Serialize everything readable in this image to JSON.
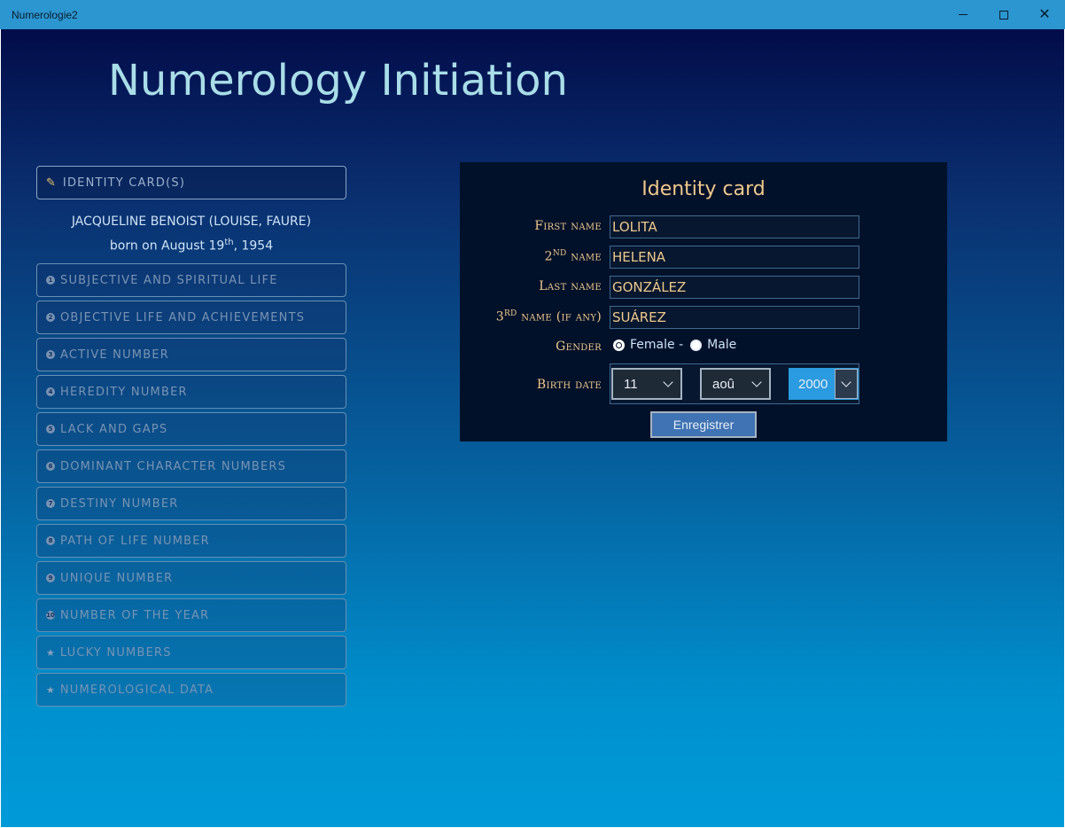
{
  "window": {
    "title": "Numerologie2",
    "minimize_icon": "minimize-icon",
    "maximize_icon": "maximize-icon",
    "close_glyph": "✕"
  },
  "header": {
    "title": "Numerology Initiation"
  },
  "menu": {
    "identity": {
      "label": "IDENTITY CARD(S)",
      "icon": "pen-icon"
    },
    "person": {
      "name_line": "JACQUELINE BENOIST (LOUISE, FAURE)",
      "born_prefix": "born on August 19",
      "born_suffix_sup": "th",
      "born_year": ", 1954"
    },
    "items": [
      {
        "label": "SUBJECTIVE AND SPIRITUAL LIFE",
        "bullet": "1"
      },
      {
        "label": "OBJECTIVE LIFE AND ACHIEVEMENTS",
        "bullet": "2"
      },
      {
        "label": "ACTIVE NUMBER",
        "bullet": "3"
      },
      {
        "label": "HEREDITY NUMBER",
        "bullet": "4"
      },
      {
        "label": "LACK AND GAPS",
        "bullet": "5"
      },
      {
        "label": "DOMINANT CHARACTER NUMBERS",
        "bullet": "6"
      },
      {
        "label": "DESTINY NUMBER",
        "bullet": "7"
      },
      {
        "label": "PATH OF LIFE NUMBER",
        "bullet": "8"
      },
      {
        "label": "UNIQUE NUMBER",
        "bullet": "9"
      },
      {
        "label": "NUMBER OF THE YEAR",
        "bullet": "10"
      },
      {
        "label": "LUCKY NUMBERS",
        "bullet": "★"
      },
      {
        "label": "NUMEROLOGICAL DATA",
        "bullet": "★"
      }
    ]
  },
  "card": {
    "title": "Identity card",
    "first_name_label": "First name",
    "first_name_value": "LOLITA",
    "second_name_label_num": "2",
    "second_name_label_sup": "ND",
    "second_name_label_rest": " name",
    "second_name_value": "HELENA",
    "last_name_label": "Last name",
    "last_name_value": "GONZÁLEZ",
    "third_name_label_num": "3",
    "third_name_label_sup": "RD",
    "third_name_label_rest": " name (if any)",
    "third_name_value": "SUÁREZ",
    "gender_label": "Gender",
    "gender_female": "Female -",
    "gender_male": "Male",
    "gender_selected": "female",
    "birth_date_label": "Birth date",
    "day_value": "11",
    "month_value": "aoû",
    "year_value": "2000",
    "save_label": "Enregistrer"
  }
}
